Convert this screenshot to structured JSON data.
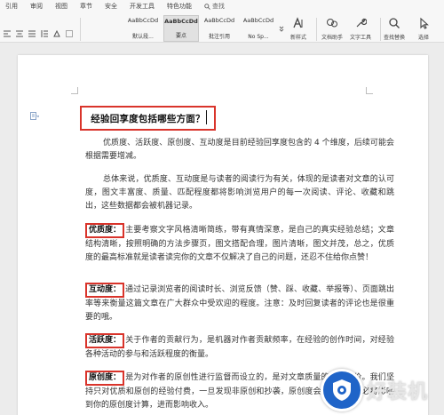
{
  "menu": {
    "items": [
      "引用",
      "审阅",
      "视图",
      "章节",
      "安全",
      "开发工具",
      "特色功能"
    ],
    "search_label": "查找"
  },
  "ribbon": {
    "styles": [
      {
        "sample": "AaBbCcDd",
        "name": "默认段..."
      },
      {
        "sample": "AaBbCcDd",
        "name": "要点"
      },
      {
        "sample": "AaBbCcDd",
        "name": "批注引用"
      },
      {
        "sample": "AaBbCcDd",
        "name": "No Sp..."
      }
    ],
    "new_style_label": "新样式",
    "doc_assistant_label": "文档助手",
    "text_tools_label": "文字工具",
    "find_replace_label": "查找替换",
    "select_label": "选择"
  },
  "document": {
    "title": "经验回享度包括哪些方面？",
    "intro": "优质度、活跃度、原创度、互动度是目前经验回享度包含的 4 个维度，后续可能会根据需要增减。",
    "overall": "总体来说，优质度、互动度是与读者的阅读行为有关，体现的是读者对文章的认可度，图文丰富度、质量、匹配程度都将影响浏览用户的每一次阅读、评论、收藏和跳出，这些数据都会被机器记录。",
    "sections": [
      {
        "label": "优质度：",
        "text": "主要考察文字风格清晰简练，带有真情深意，是自己的真实经验总结；文章结构清晰，按照明确的方法步骤页，图文搭配合理，图片清晰，图文并茂，总之，优质度的最高标准就是读者读完你的文章不仅解决了自己的问题，还忍不住给你点赞！"
      },
      {
        "label": "互动度：",
        "text": "通过记录浏览者的阅读时长、浏览反馈（赞、踩、收藏、举报等）、页面跳出率等来衡量这篇文章在广大群众中受欢迎的程度。注意：及时回复读者的评论也是很重要的哦。"
      },
      {
        "label": "活跃度：",
        "text": "关于作者的贡献行为，是机器对作者贡献频率，在经验的创作时间，对经验各种活动的参与和活跃程度的衡量。"
      },
      {
        "label": "原创度：",
        "text": "是为对作者的原创性进行监督而设立的，是对文章质量的客观评价。我们坚持只对优质和原创的经验付费，一旦发现非原创和抄袭，原创度会大打折扣，必将影响到你的原创度计算，进而影响收入。"
      }
    ]
  },
  "watermark": {
    "text": "好装机"
  }
}
